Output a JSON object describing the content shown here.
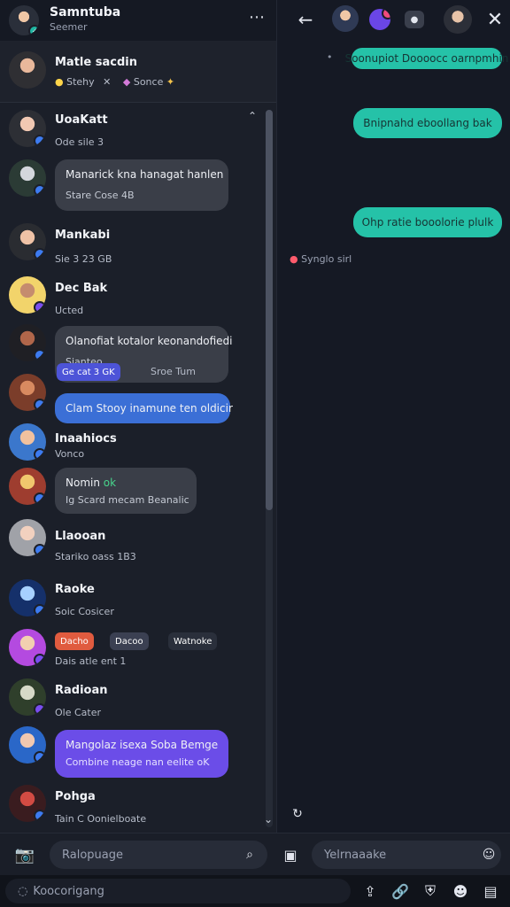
{
  "window": {
    "title": "Samntuba",
    "subtitle": "Seemer"
  },
  "pinned": {
    "name": "Matle sacdin",
    "status_left": "Stehy",
    "status_right": "Sonce"
  },
  "chats": [
    {
      "name": "UoaKatt",
      "meta": "Ode sile 3"
    },
    {
      "bubble1": "Manarick kna hanagat hanlen",
      "bubble2": "Stare Cose 4B"
    },
    {
      "name": "Mankabi",
      "meta": "Sie 3 23 GB"
    },
    {
      "name": "Dec Bak",
      "meta": "Ucted"
    },
    {
      "bubble1": "Olanofiat kotalor keonandofiedi",
      "bubble2": "Sianteo",
      "chip_left": "Ge cat 3 GK",
      "chip_right": "Sroe Tum"
    },
    {
      "bubble1": "Clam Stooy inamune ten oldicir"
    },
    {
      "name": "Inaahiocs",
      "meta": "Vonco"
    },
    {
      "bubble1": "Nomin",
      "highlight": "ok",
      "bubble2": "Ig Scard mecam Beanalic"
    },
    {
      "name": "Llaooan",
      "meta": "Stariko oass 1B3"
    },
    {
      "name": "Raoke",
      "meta": "Soic Cosicer"
    },
    {
      "chip1": "Dacho",
      "chip2": "Dacoo",
      "chip3": "Watnoke",
      "meta": "Dais atle ent 1"
    },
    {
      "name": "Radioan",
      "meta": "Ole Cater"
    },
    {
      "bubble1": "Mangolaz isexa Soba Bemge",
      "bubble2": "Combine neage nan eelite oK"
    },
    {
      "name": "Pohga",
      "meta": "Tain C Oonielboate"
    }
  ],
  "right_messages": [
    {
      "text": "Soonupiot Doooocc oarnpmhin"
    },
    {
      "text": "Bnipnahd eboollang bak"
    },
    {
      "text": "Ohp ratie booolorie plulk"
    }
  ],
  "right_system": "Synglo sirl",
  "composer": {
    "left_placeholder": "Ralopuage",
    "right_placeholder": "Yelrnaaake"
  },
  "footer": {
    "search_placeholder": "Koocorigang"
  }
}
